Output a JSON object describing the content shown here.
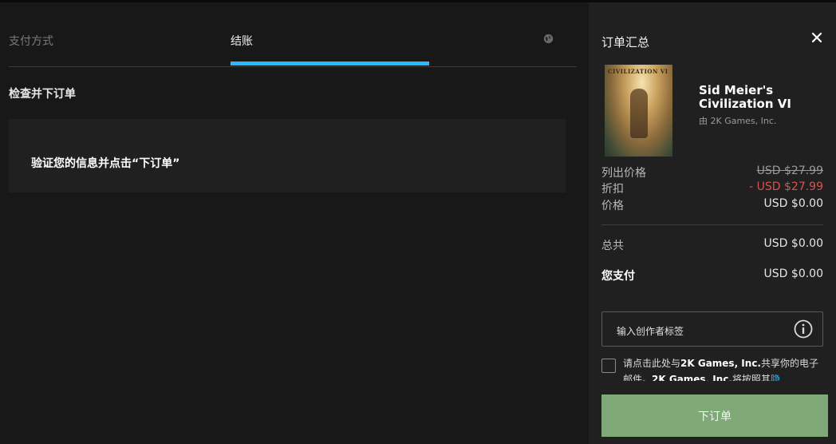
{
  "steps": {
    "payment_label": "支付方式",
    "checkout_label": "结账"
  },
  "review": {
    "title": "检查并下订单",
    "notice": "验证您的信息并点击“下订单”"
  },
  "summary": {
    "title": "订单汇总",
    "game_title": "Sid Meier's Civilization VI",
    "publisher": "由 2K Games, Inc.",
    "cover_text": "CIVILIZATION VI",
    "list_price_label": "列出价格",
    "list_price": "USD $27.99",
    "discount_label": "折扣",
    "discount": "- USD $27.99",
    "price_label": "价格",
    "price": "USD $0.00",
    "total_label": "总共",
    "total": "USD $0.00",
    "you_pay_label": "您支付",
    "you_pay": "USD $0.00",
    "creator_tag_label": "输入创作者标签",
    "consent_part1": "请点击此处与",
    "consent_company1": "2K Games, Inc.",
    "consent_part2": "共享你的电子邮件。",
    "consent_company2": "2K Games, Inc.",
    "consent_part3": "将按照其",
    "consent_link": "隐",
    "order_button": "下订单"
  },
  "colors": {
    "accent": "#26bbff",
    "order_button": "#7fa977",
    "discount": "#d9534f"
  },
  "icons": [
    "globe-icon",
    "close-icon",
    "info-icon"
  ]
}
